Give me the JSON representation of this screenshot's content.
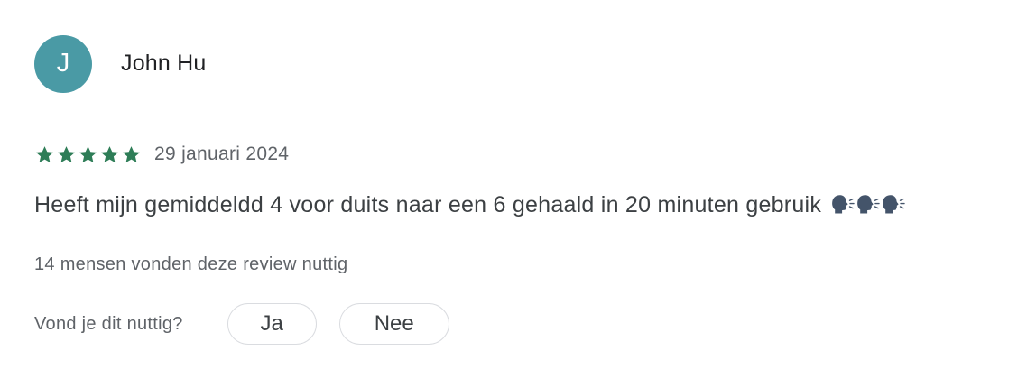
{
  "review": {
    "author": {
      "initial": "J",
      "name": "John Hu",
      "avatar_color": "#4a9aa5"
    },
    "rating": {
      "stars": 5,
      "max_stars": 5,
      "star_color": "#2e7d57"
    },
    "date": "29 januari 2024",
    "text": "Heeft mijn gemiddeldd 4 voor duits naar een 6 gehaald in 20 minuten gebruik",
    "emoji_icons": [
      "speaking-head-icon",
      "speaking-head-icon",
      "speaking-head-icon"
    ],
    "helpful_count_text": "14 mensen vonden deze review nuttig",
    "helpful_question": "Vond je dit nuttig?",
    "buttons": {
      "yes_label": "Ja",
      "no_label": "Nee"
    }
  }
}
